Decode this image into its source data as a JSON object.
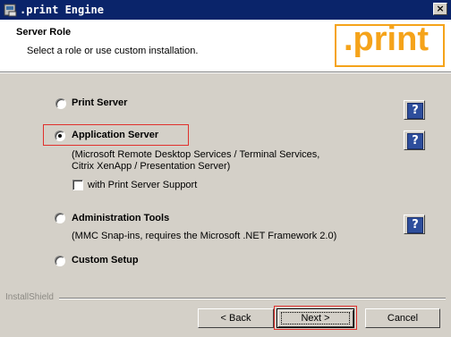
{
  "window": {
    "title": ".print Engine",
    "close_glyph": "×"
  },
  "banner": {
    "title": "Server Role",
    "subtitle": "Select a role or use custom installation.",
    "logo_text": ".print",
    "logo_color": "#f5a31a"
  },
  "options": [
    {
      "label": "Print Server",
      "selected": false
    },
    {
      "label": "Application Server",
      "selected": true,
      "description": [
        "(Microsoft Remote Desktop Services / Terminal Services,",
        "Citrix XenApp / Presentation Server)"
      ],
      "checkbox_label": "with Print Server Support",
      "checkbox_checked": false
    },
    {
      "label": "Administration Tools",
      "selected": false,
      "description": [
        "(MMC Snap-ins, requires the Microsoft .NET Framework 2.0)"
      ]
    },
    {
      "label": "Custom Setup",
      "selected": false
    }
  ],
  "help": {
    "glyph": "?"
  },
  "footer": {
    "brand": "InstallShield"
  },
  "buttons": {
    "back": "< Back",
    "next": "Next >",
    "cancel": "Cancel"
  },
  "colors": {
    "titlebar": "#0a246a",
    "highlight": "#e0302c",
    "help_icon": "#2e4e9c"
  }
}
